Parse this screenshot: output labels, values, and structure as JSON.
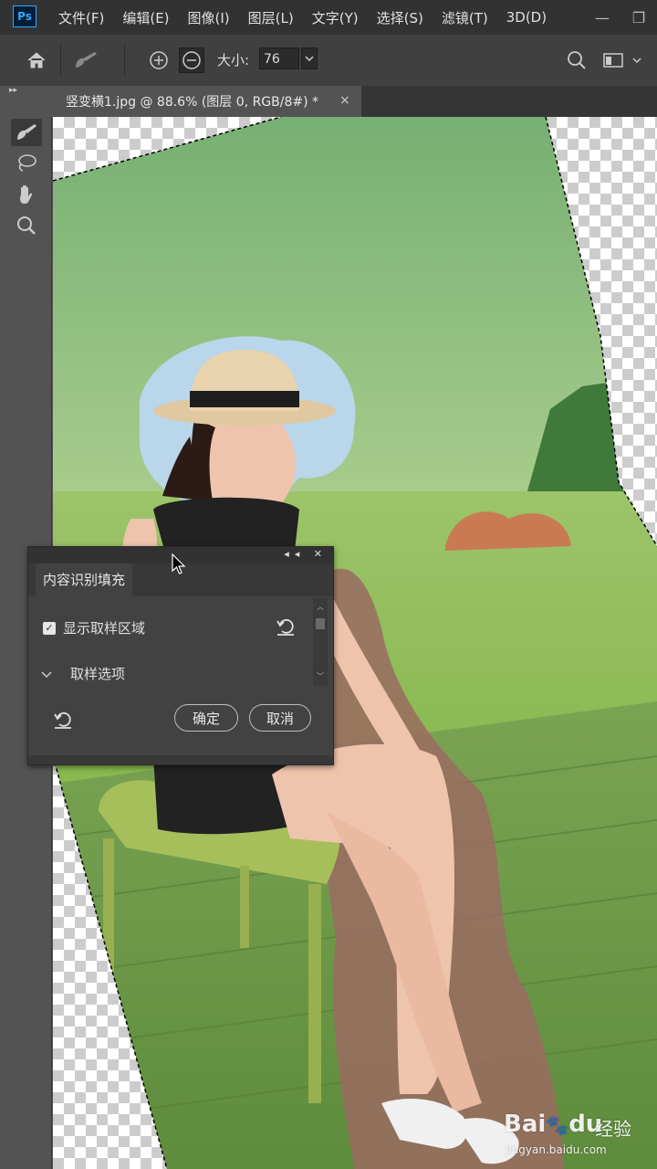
{
  "app": {
    "logo": "Ps"
  },
  "menu": [
    "文件(F)",
    "编辑(E)",
    "图像(I)",
    "图层(L)",
    "文字(Y)",
    "选择(S)",
    "滤镜(T)",
    "3D(D)"
  ],
  "window_controls": {
    "minimize": "—",
    "restore": "❐"
  },
  "options": {
    "size_label": "大小:",
    "size_value": "76"
  },
  "document": {
    "tab_title": "竖变横1.jpg @ 88.6% (图层 0, RGB/8#) *",
    "close": "×"
  },
  "panel": {
    "tab": "内容识别填充",
    "show_sampling_area": "显示取样区域",
    "show_sampling_checked": true,
    "sampling_options": "取样选项",
    "ok": "确定",
    "cancel": "取消"
  },
  "watermark": {
    "brand": "Bai",
    "brand2": "du",
    "jingyan": "经验",
    "url": "jingyan.baidu.com"
  },
  "colors": {
    "ui_dark": "#323232",
    "ui_mid": "#535353",
    "accent": "#31a8ff"
  }
}
